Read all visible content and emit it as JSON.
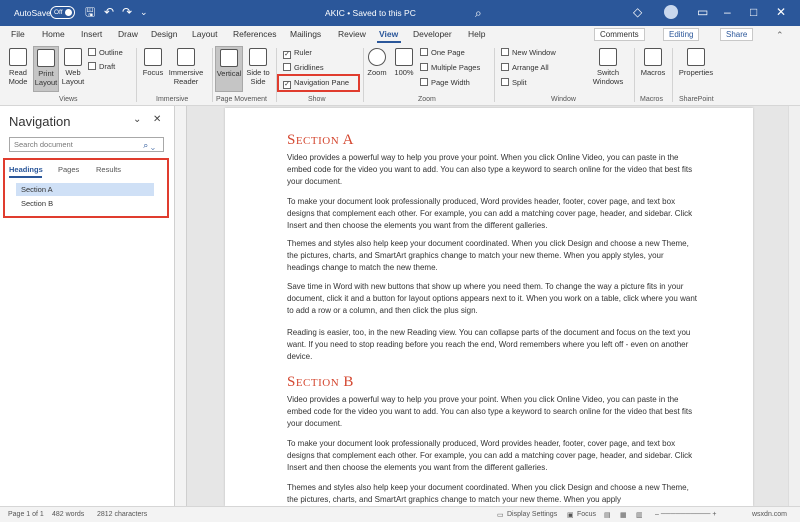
{
  "titlebar": {
    "autosave": "AutoSave",
    "toggle": "Off",
    "title": "AKIC  •  Saved to this PC"
  },
  "tabs": [
    "File",
    "Home",
    "Insert",
    "Draw",
    "Design",
    "Layout",
    "References",
    "Mailings",
    "Review",
    "View",
    "Developer",
    "Help"
  ],
  "top_buttons": {
    "comments": "Comments",
    "editing": "Editing",
    "share": "Share"
  },
  "ribbon": {
    "views": {
      "read_mode": "Read Mode",
      "print_layout": "Print Layout",
      "web_layout": "Web Layout",
      "outline": "Outline",
      "draft": "Draft",
      "label": "Views"
    },
    "immersive": {
      "focus": "Focus",
      "immersive_reader": "Immersive Reader",
      "label": "Immersive"
    },
    "page_movement": {
      "vertical": "Vertical",
      "side_to_side": "Side to Side",
      "label": "Page Movement"
    },
    "show": {
      "ruler": "Ruler",
      "gridlines": "Gridlines",
      "navigation_pane": "Navigation Pane",
      "label": "Show"
    },
    "zoom": {
      "zoom": "Zoom",
      "hundred": "100%",
      "one_page": "One Page",
      "multiple_pages": "Multiple Pages",
      "page_width": "Page Width",
      "label": "Zoom"
    },
    "window": {
      "new_window": "New Window",
      "arrange_all": "Arrange All",
      "split": "Split",
      "switch_windows": "Switch Windows",
      "label": "Window"
    },
    "macros": {
      "macros": "Macros",
      "label": "Macros"
    },
    "sharepoint": {
      "properties": "Properties",
      "label": "SharePoint"
    }
  },
  "nav": {
    "title": "Navigation",
    "search_placeholder": "Search document",
    "tabs": [
      "Headings",
      "Pages",
      "Results"
    ],
    "headings": [
      "Section A",
      "Section B"
    ]
  },
  "document": {
    "section_a": "Section A",
    "section_b": "Section B",
    "p1": "Video provides a powerful way to help you prove your point. When you click Online Video, you can paste in the embed code for the video you want to add. You can also type a keyword to search online for the video that best fits your document.",
    "p2": "To make your document look professionally produced, Word provides header, footer, cover page, and text box designs that complement each other. For example, you can add a matching cover page, header, and sidebar. Click Insert and then choose the elements you want from the different galleries.",
    "p3": "Themes and styles also help keep your document coordinated. When you click Design and choose a new Theme, the pictures, charts, and SmartArt graphics change to match your new theme. When you apply styles, your headings change to match the new theme.",
    "p4": "Save time in Word with new buttons that show up where you need them. To change the way a picture fits in your document, click it and a button for layout options appears next to it. When you work on a table, click where you want to add a row or a column, and then click the plus sign.",
    "p5": "Reading is easier, too, in the new Reading view. You can collapse parts of the document and focus on the text you want. If you need to stop reading before you reach the end, Word remembers where you left off - even on another device.",
    "p6": "Video provides a powerful way to help you prove your point. When you click Online Video, you can paste in the embed code for the video you want to add. You can also type a keyword to search online for the video that best fits your document.",
    "p7": "To make your document look professionally produced, Word provides header, footer, cover page, and text box designs that complement each other. For example, you can add a matching cover page, header, and sidebar. Click Insert and then choose the elements you want from the different galleries.",
    "p8": "Themes and styles also help keep your document coordinated. When you click Design and choose a new Theme, the pictures, charts, and SmartArt graphics change to match your new theme. When you apply"
  },
  "status": {
    "page": "Page 1 of 1",
    "words": "482 words",
    "chars": "2812 characters",
    "display": "Display Settings",
    "focus": "Focus",
    "watermark": "wsxdn.com"
  },
  "colors": {
    "brand": "#2b579a",
    "highlight": "#e03c2e",
    "heading": "#d44730"
  }
}
